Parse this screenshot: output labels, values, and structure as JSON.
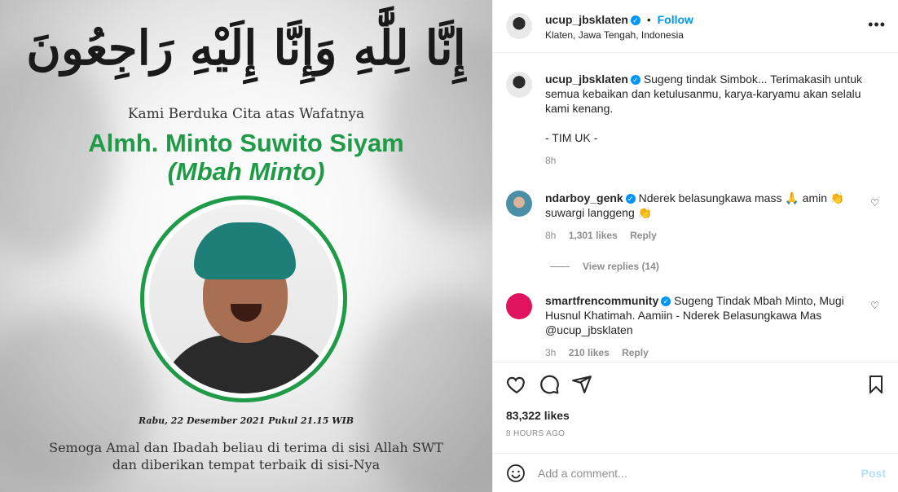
{
  "post_image": {
    "arabic_heading": "إِنَّا لِلَّٰهِ وَإِنَّا إِلَيْهِ رَاجِعُونَ",
    "subtitle": "Kami Berduka Cita atas Wafatnya",
    "name": "Almh. Minto Suwito Siyam",
    "nickname": "(Mbah Minto)",
    "date": "Rabu, 22 Desember 2021 Pukul 21.15 WIB",
    "prayer_line1": "Semoga Amal dan Ibadah beliau di terima di sisi Allah SWT",
    "prayer_line2": "dan diberikan tempat terbaik di sisi-Nya",
    "accent_color": "#1f9a47"
  },
  "header": {
    "username": "ucup_jbsklaten",
    "follow_label": "Follow",
    "location": "Klaten, Jawa Tengah, Indonesia",
    "more_icon": "more-horizontal-icon"
  },
  "caption": {
    "username": "ucup_jbsklaten",
    "text": "Sugeng tindak Simbok... Terimakasih untuk semua kebaikan dan ketulusanmu, karya-karyamu akan selalu kami kenang.",
    "signature": "- TIM UK -",
    "time": "8h"
  },
  "comments": [
    {
      "username": "ndarboy_genk",
      "text": "Nderek belasungkawa mass 🙏 amin 👏 suwargi langgeng 👏",
      "time": "8h",
      "likes": "1,301 likes",
      "reply_label": "Reply",
      "view_replies": "View replies (14)"
    },
    {
      "username": "smartfrencommunity",
      "text": "Sugeng Tindak Mbah Minto, Mugi Husnul Khatimah. Aamiin - Nderek Belasungkawa Mas @ucup_jbsklaten",
      "time": "3h",
      "likes": "210 likes",
      "reply_label": "Reply"
    }
  ],
  "actions": {
    "likes": "83,322 likes",
    "time_ago": "8 HOURS AGO"
  },
  "add_comment": {
    "placeholder": "Add a comment...",
    "post_label": "Post"
  },
  "colors": {
    "link_blue": "#0095f6",
    "post_disabled": "#b2dffc",
    "muted": "#8e8e8e"
  }
}
